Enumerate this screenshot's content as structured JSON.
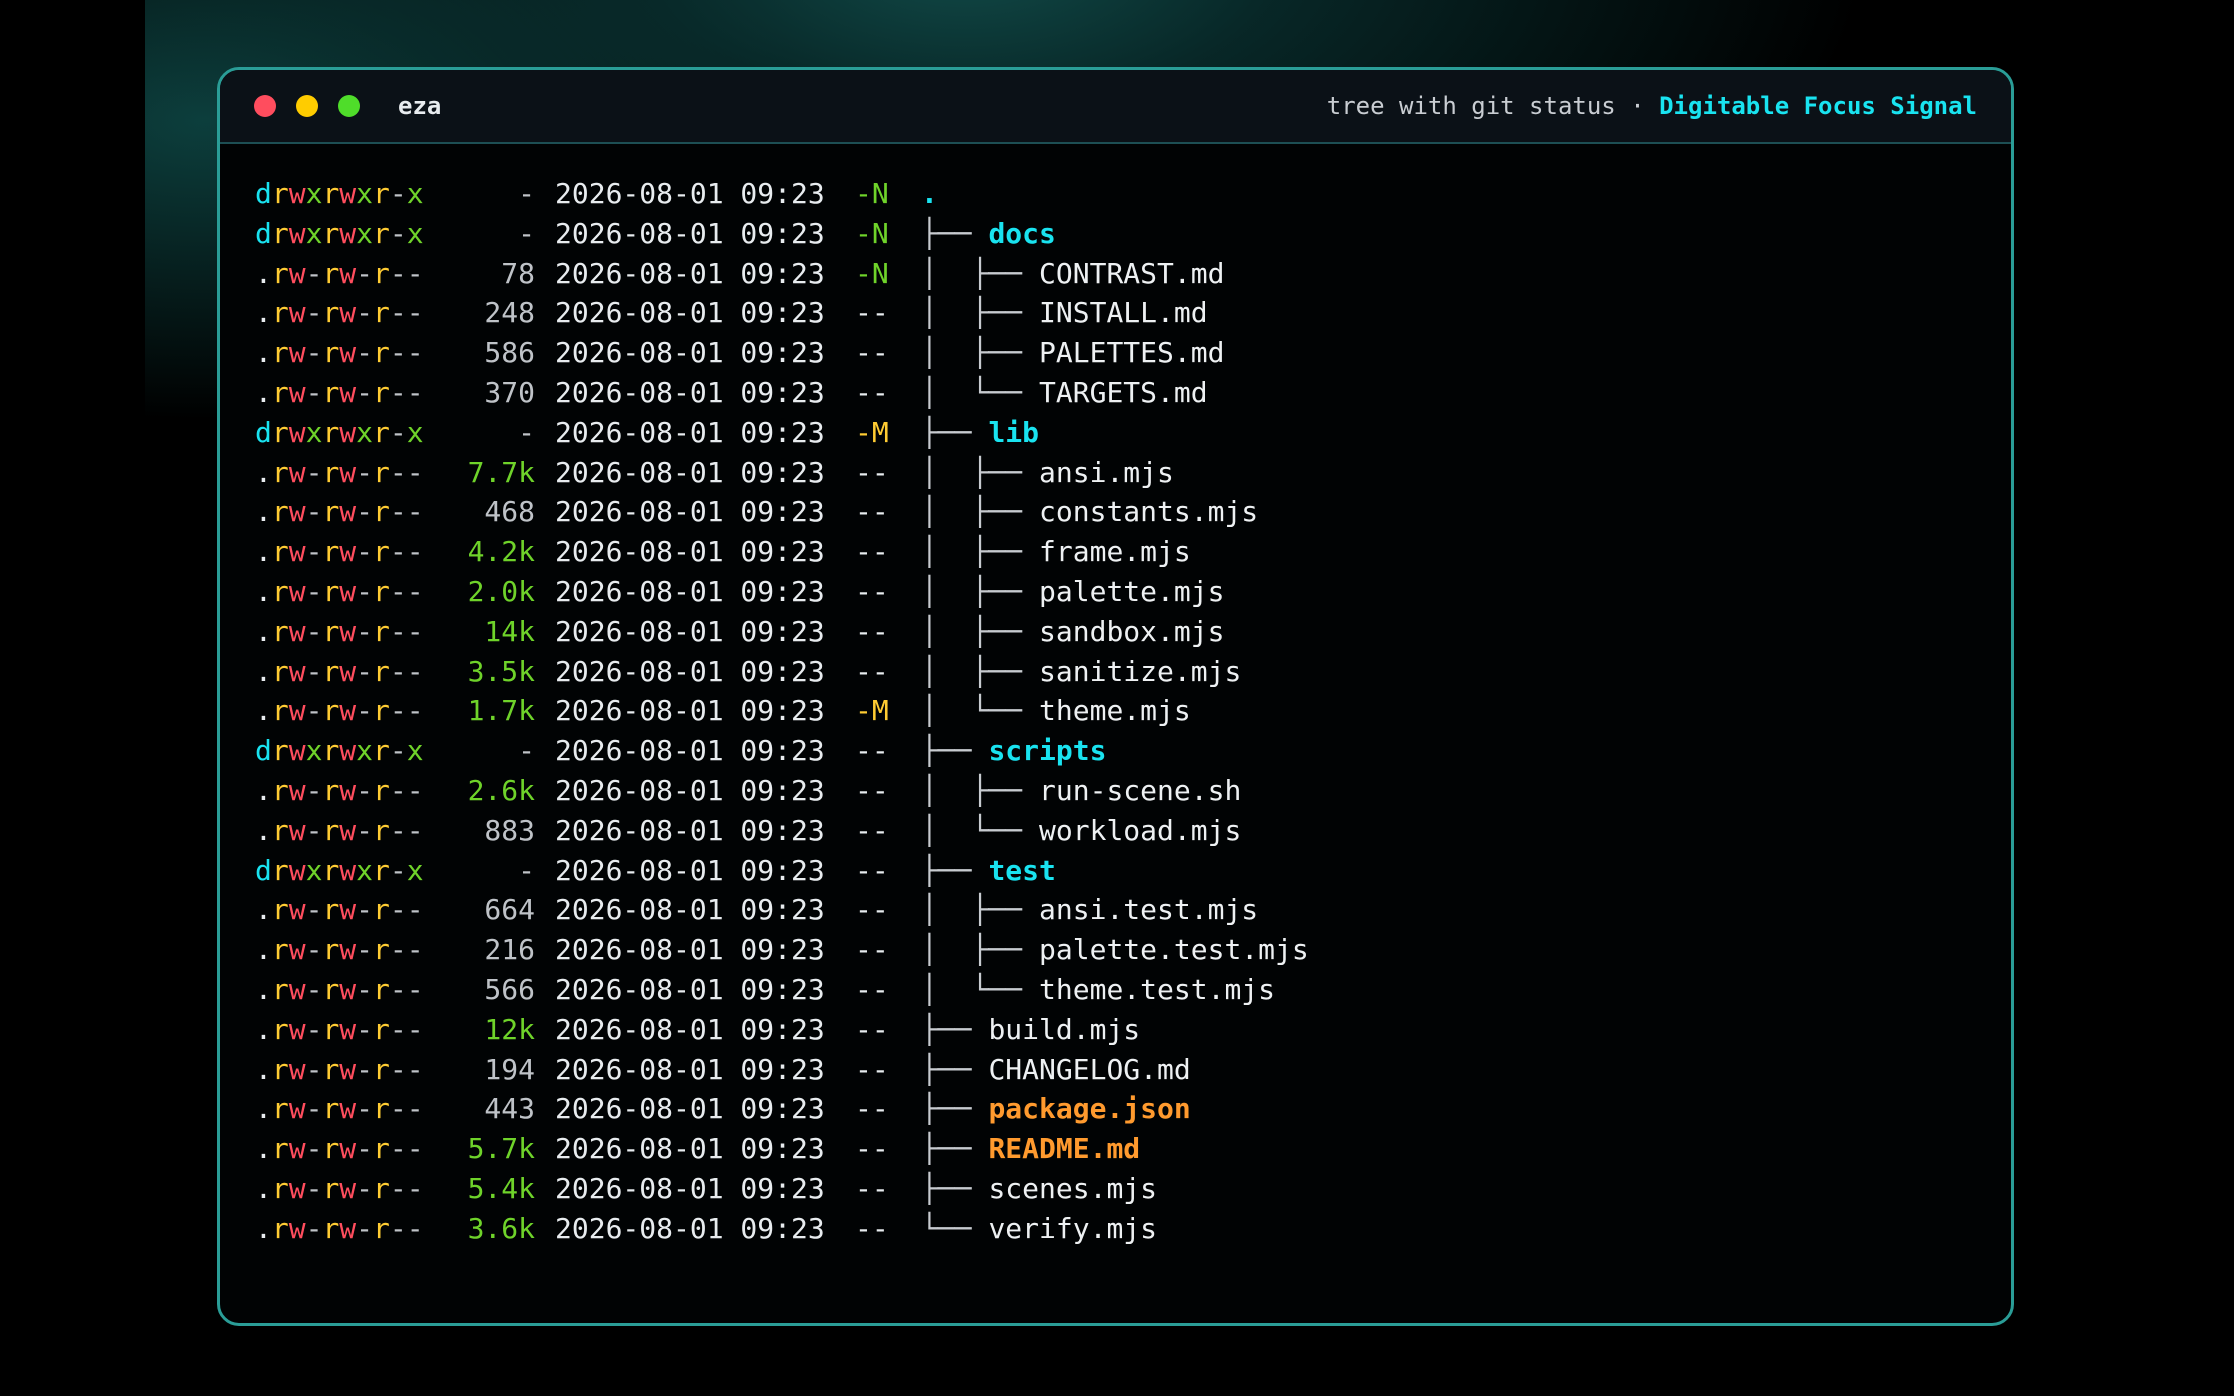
{
  "window": {
    "title": "eza",
    "subtitle_muted": "tree with git status ·",
    "subtitle_accent": "Digitable Focus Signal",
    "controls": [
      "close",
      "minimize",
      "maximize"
    ]
  },
  "colors": {
    "directory": "#19e3f0",
    "special_file": "#ff9a2e",
    "git_new": "#6fd32a",
    "git_modified": "#ffcc33",
    "border": "#2a9d97"
  },
  "rows": [
    {
      "perm": "drwxrwxr-x",
      "size": "-",
      "date": "2026-08-01 09:23",
      "git": "-N",
      "tree": "",
      "name": ".",
      "kind": "root"
    },
    {
      "perm": "drwxrwxr-x",
      "size": "-",
      "date": "2026-08-01 09:23",
      "git": "-N",
      "tree": "├── ",
      "name": "docs",
      "kind": "dir"
    },
    {
      "perm": ".rw-rw-r--",
      "size": "78",
      "date": "2026-08-01 09:23",
      "git": "-N",
      "tree": "│  ├── ",
      "name": "CONTRAST.md",
      "kind": "file"
    },
    {
      "perm": ".rw-rw-r--",
      "size": "248",
      "date": "2026-08-01 09:23",
      "git": "--",
      "tree": "│  ├── ",
      "name": "INSTALL.md",
      "kind": "file"
    },
    {
      "perm": ".rw-rw-r--",
      "size": "586",
      "date": "2026-08-01 09:23",
      "git": "--",
      "tree": "│  ├── ",
      "name": "PALETTES.md",
      "kind": "file"
    },
    {
      "perm": ".rw-rw-r--",
      "size": "370",
      "date": "2026-08-01 09:23",
      "git": "--",
      "tree": "│  └── ",
      "name": "TARGETS.md",
      "kind": "file"
    },
    {
      "perm": "drwxrwxr-x",
      "size": "-",
      "date": "2026-08-01 09:23",
      "git": "-M",
      "tree": "├── ",
      "name": "lib",
      "kind": "dir"
    },
    {
      "perm": ".rw-rw-r--",
      "size": "7.7k",
      "date": "2026-08-01 09:23",
      "git": "--",
      "tree": "│  ├── ",
      "name": "ansi.mjs",
      "kind": "file"
    },
    {
      "perm": ".rw-rw-r--",
      "size": "468",
      "date": "2026-08-01 09:23",
      "git": "--",
      "tree": "│  ├── ",
      "name": "constants.mjs",
      "kind": "file"
    },
    {
      "perm": ".rw-rw-r--",
      "size": "4.2k",
      "date": "2026-08-01 09:23",
      "git": "--",
      "tree": "│  ├── ",
      "name": "frame.mjs",
      "kind": "file"
    },
    {
      "perm": ".rw-rw-r--",
      "size": "2.0k",
      "date": "2026-08-01 09:23",
      "git": "--",
      "tree": "│  ├── ",
      "name": "palette.mjs",
      "kind": "file"
    },
    {
      "perm": ".rw-rw-r--",
      "size": "14k",
      "date": "2026-08-01 09:23",
      "git": "--",
      "tree": "│  ├── ",
      "name": "sandbox.mjs",
      "kind": "file"
    },
    {
      "perm": ".rw-rw-r--",
      "size": "3.5k",
      "date": "2026-08-01 09:23",
      "git": "--",
      "tree": "│  ├── ",
      "name": "sanitize.mjs",
      "kind": "file"
    },
    {
      "perm": ".rw-rw-r--",
      "size": "1.7k",
      "date": "2026-08-01 09:23",
      "git": "-M",
      "tree": "│  └── ",
      "name": "theme.mjs",
      "kind": "file"
    },
    {
      "perm": "drwxrwxr-x",
      "size": "-",
      "date": "2026-08-01 09:23",
      "git": "--",
      "tree": "├── ",
      "name": "scripts",
      "kind": "dir"
    },
    {
      "perm": ".rw-rw-r--",
      "size": "2.6k",
      "date": "2026-08-01 09:23",
      "git": "--",
      "tree": "│  ├── ",
      "name": "run-scene.sh",
      "kind": "file"
    },
    {
      "perm": ".rw-rw-r--",
      "size": "883",
      "date": "2026-08-01 09:23",
      "git": "--",
      "tree": "│  └── ",
      "name": "workload.mjs",
      "kind": "file"
    },
    {
      "perm": "drwxrwxr-x",
      "size": "-",
      "date": "2026-08-01 09:23",
      "git": "--",
      "tree": "├── ",
      "name": "test",
      "kind": "dir"
    },
    {
      "perm": ".rw-rw-r--",
      "size": "664",
      "date": "2026-08-01 09:23",
      "git": "--",
      "tree": "│  ├── ",
      "name": "ansi.test.mjs",
      "kind": "file"
    },
    {
      "perm": ".rw-rw-r--",
      "size": "216",
      "date": "2026-08-01 09:23",
      "git": "--",
      "tree": "│  ├── ",
      "name": "palette.test.mjs",
      "kind": "file"
    },
    {
      "perm": ".rw-rw-r--",
      "size": "566",
      "date": "2026-08-01 09:23",
      "git": "--",
      "tree": "│  └── ",
      "name": "theme.test.mjs",
      "kind": "file"
    },
    {
      "perm": ".rw-rw-r--",
      "size": "12k",
      "date": "2026-08-01 09:23",
      "git": "--",
      "tree": "├── ",
      "name": "build.mjs",
      "kind": "file"
    },
    {
      "perm": ".rw-rw-r--",
      "size": "194",
      "date": "2026-08-01 09:23",
      "git": "--",
      "tree": "├── ",
      "name": "CHANGELOG.md",
      "kind": "file"
    },
    {
      "perm": ".rw-rw-r--",
      "size": "443",
      "date": "2026-08-01 09:23",
      "git": "--",
      "tree": "├── ",
      "name": "package.json",
      "kind": "special"
    },
    {
      "perm": ".rw-rw-r--",
      "size": "5.7k",
      "date": "2026-08-01 09:23",
      "git": "--",
      "tree": "├── ",
      "name": "README.md",
      "kind": "special"
    },
    {
      "perm": ".rw-rw-r--",
      "size": "5.4k",
      "date": "2026-08-01 09:23",
      "git": "--",
      "tree": "├── ",
      "name": "scenes.mjs",
      "kind": "file"
    },
    {
      "perm": ".rw-rw-r--",
      "size": "3.6k",
      "date": "2026-08-01 09:23",
      "git": "--",
      "tree": "└── ",
      "name": "verify.mjs",
      "kind": "file"
    }
  ]
}
